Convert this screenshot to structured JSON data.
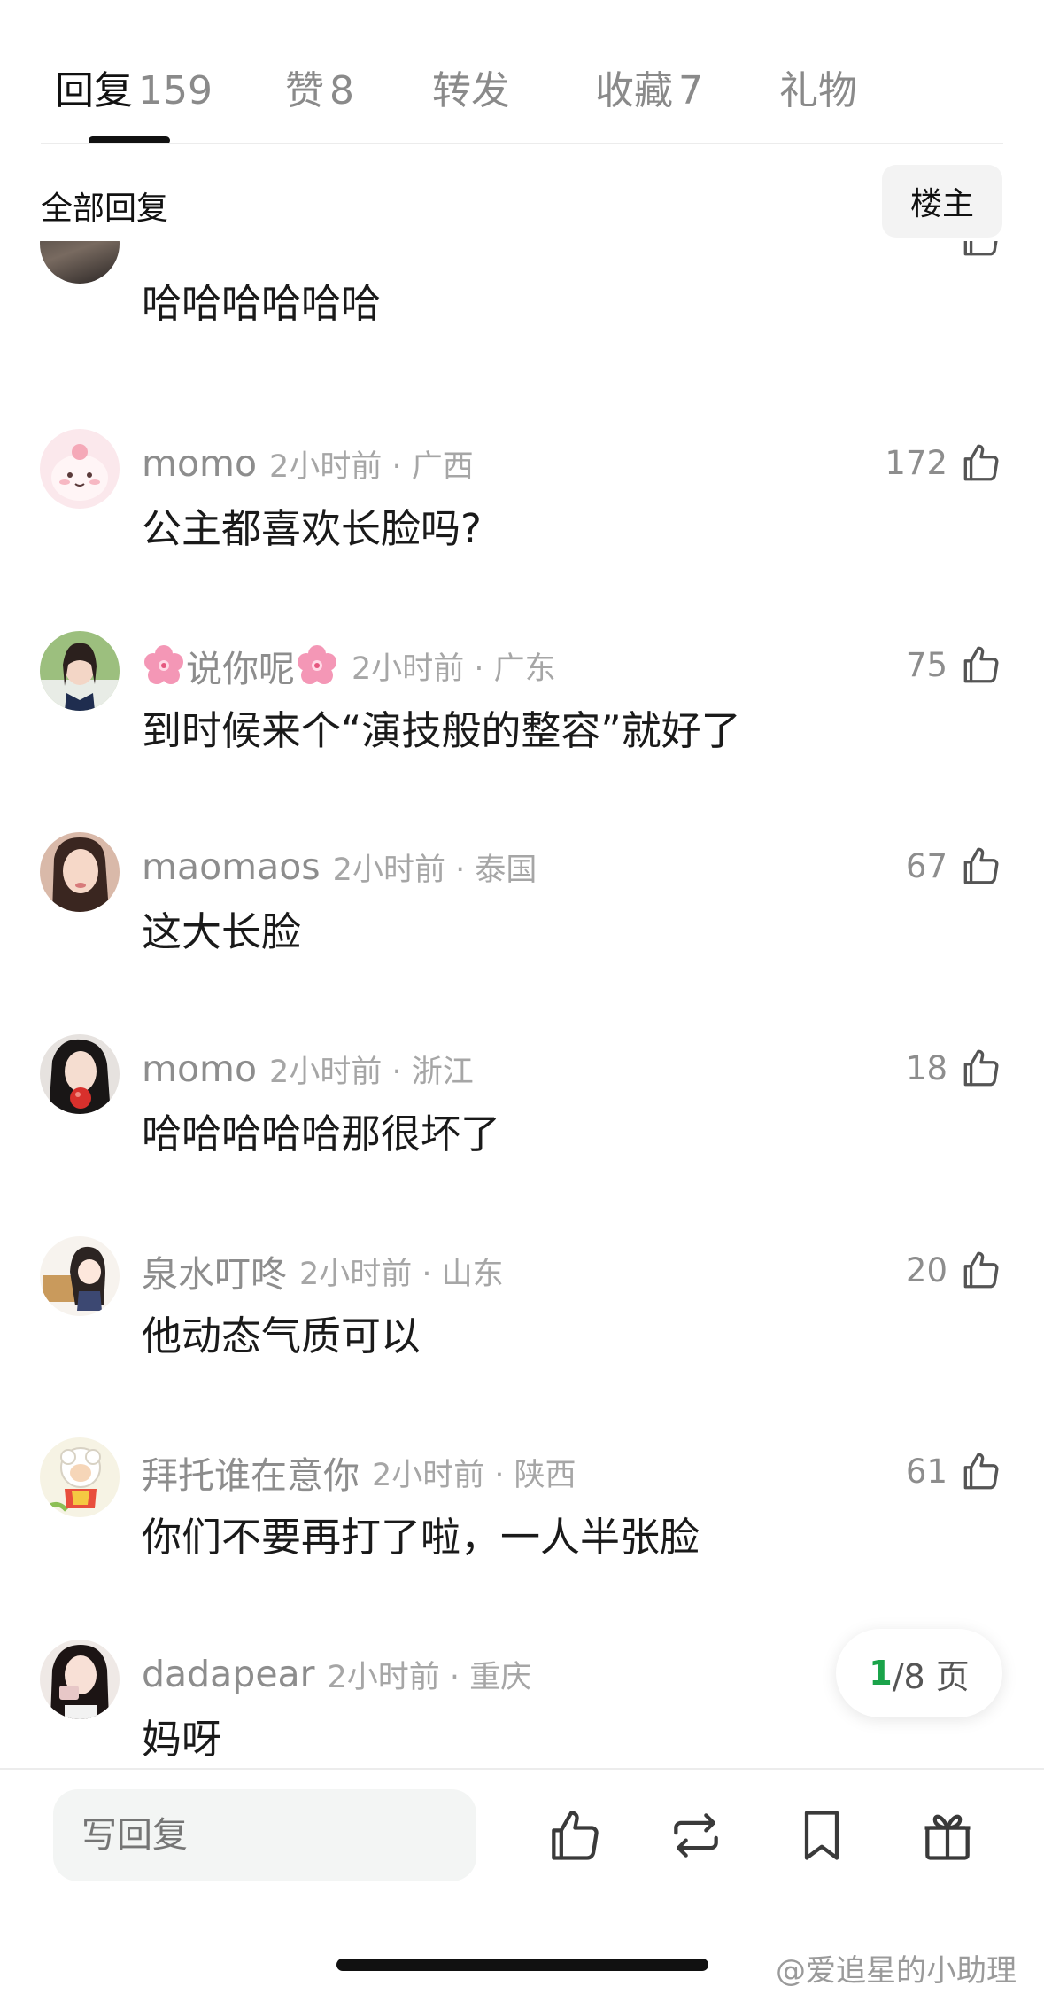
{
  "tabs": [
    {
      "label": "回复",
      "count": "159"
    },
    {
      "label": "赞",
      "count": "8"
    },
    {
      "label": "转发",
      "count": ""
    },
    {
      "label": "收藏",
      "count": "7"
    },
    {
      "label": "礼物",
      "count": ""
    }
  ],
  "filter": {
    "all_replies": "全部回复",
    "op_only": "楼主"
  },
  "comments": [
    {
      "username": "",
      "meta": "",
      "likes": "",
      "text": "哈哈哈哈哈哈"
    },
    {
      "username": "momo",
      "meta": "2小时前 · 广西",
      "likes": "172",
      "text": "公主都喜欢长脸吗?"
    },
    {
      "username": "说你呢",
      "meta": "2小时前 · 广东",
      "likes": "75",
      "text": "到时候来个“演技般的整容”就好了"
    },
    {
      "username": "maomaos",
      "meta": "2小时前 · 泰国",
      "likes": "67",
      "text": "这大长脸"
    },
    {
      "username": "momo",
      "meta": "2小时前 · 浙江",
      "likes": "18",
      "text": "哈哈哈哈哈那很坏了"
    },
    {
      "username": "泉水叮咚",
      "meta": "2小时前 · 山东",
      "likes": "20",
      "text": "他动态气质可以"
    },
    {
      "username": "拜托谁在意你",
      "meta": "2小时前 · 陕西",
      "likes": "61",
      "text": "你们不要再打了啦，一人半张脸"
    },
    {
      "username": "dadapear",
      "meta": "2小时前 · 重庆",
      "likes": "",
      "text": "妈呀"
    }
  ],
  "pager": {
    "current": "1",
    "total_label": "/8 页"
  },
  "bottom_bar": {
    "reply_placeholder": "写回复"
  },
  "watermark": "@爱追星的小助理",
  "colors": {
    "accent_green": "#1aa34a",
    "text_primary": "#1a1a1a",
    "text_muted": "#8d8d8d"
  }
}
